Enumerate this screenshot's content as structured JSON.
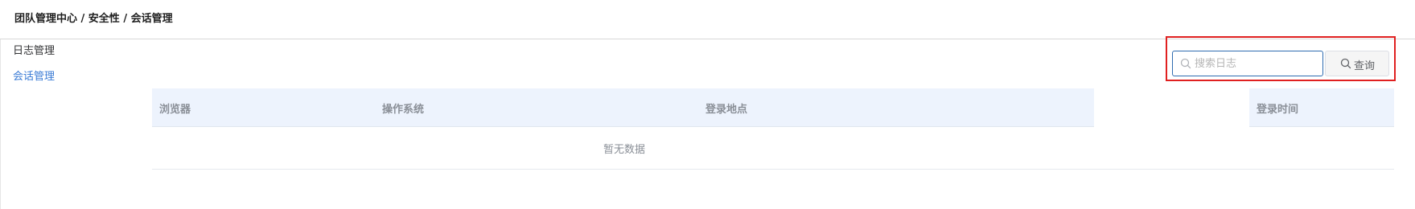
{
  "breadcrumb": {
    "text": "团队管理中心 / 安全性 / 会话管理"
  },
  "sidebar": {
    "items": [
      {
        "label": "日志管理",
        "active": false
      },
      {
        "label": "会话管理",
        "active": true
      }
    ],
    "active_color": "#3a7bd5"
  },
  "search": {
    "value": "",
    "placeholder": "搜索日志",
    "icon": "search-icon",
    "button_label": "查询",
    "button_icon": "search-icon",
    "highlight_color": "#e02020"
  },
  "table": {
    "columns": [
      "浏览器",
      "操作系统",
      "登录地点",
      "登录时间"
    ],
    "empty_text": "暂无数据",
    "header_bg": "#edf3fd"
  }
}
